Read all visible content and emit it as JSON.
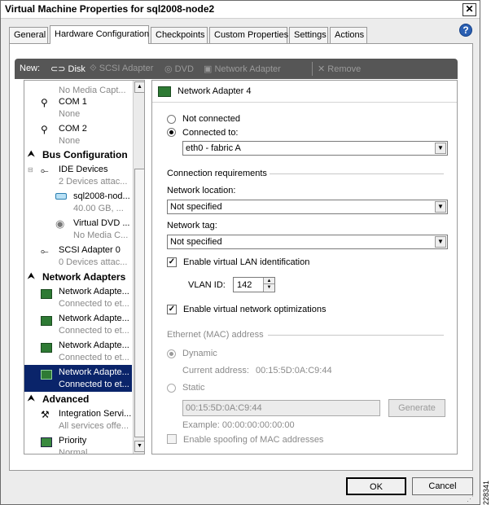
{
  "window": {
    "title": "Virtual Machine Properties for sql2008-node2",
    "close": "✕",
    "help": "?"
  },
  "tabs": [
    {
      "label": "General"
    },
    {
      "label": "Hardware Configuration"
    },
    {
      "label": "Checkpoints"
    },
    {
      "label": "Custom Properties"
    },
    {
      "label": "Settings"
    },
    {
      "label": "Actions"
    }
  ],
  "toolbar": {
    "new_label": "New:",
    "disk": "Disk",
    "scsi": "SCSI Adapter",
    "dvd": "DVD",
    "netadapter": "Network Adapter",
    "remove": "Remove"
  },
  "tree": {
    "rows": [
      {
        "t1": "",
        "t2": "No Media Capt..."
      },
      {
        "t1": "COM 1",
        "t2": "None"
      },
      {
        "t1": "COM 2",
        "t2": "None"
      },
      {
        "section": "Bus Configuration"
      },
      {
        "t1": "IDE Devices",
        "t2": "2 Devices attac..."
      },
      {
        "t1": "sql2008-nod...",
        "t2": "40.00 GB, ..."
      },
      {
        "t1": "Virtual DVD ...",
        "t2": "No Media C..."
      },
      {
        "t1": "SCSI Adapter 0",
        "t2": "0 Devices attac..."
      },
      {
        "section": "Network Adapters"
      },
      {
        "t1": "Network Adapte...",
        "t2": "Connected to et..."
      },
      {
        "t1": "Network Adapte...",
        "t2": "Connected to et..."
      },
      {
        "t1": "Network Adapte...",
        "t2": "Connected to et..."
      },
      {
        "t1": "Network Adapte...",
        "t2": "Connected to et..."
      },
      {
        "section": "Advanced"
      },
      {
        "t1": "Integration Servi...",
        "t2": "All services offe..."
      },
      {
        "t1": "Priority",
        "t2": "Normal"
      }
    ]
  },
  "detail": {
    "header": "Network Adapter 4",
    "not_connected": "Not connected",
    "connected_to": "Connected to:",
    "connected_value": "eth0 - fabric A",
    "conn_req": "Connection requirements",
    "net_location_label": "Network location:",
    "net_location_value": "Not specified",
    "net_tag_label": "Network tag:",
    "net_tag_value": "Not specified",
    "enable_vlan": "Enable virtual LAN identification",
    "vlan_label": "VLAN ID:",
    "vlan_value": "142",
    "enable_opt": "Enable virtual network optimizations",
    "mac_section": "Ethernet (MAC) address",
    "dynamic": "Dynamic",
    "current_label": "Current address:",
    "current_value": "00:15:5D:0A:C9:44",
    "static": "Static",
    "static_value": "00:15:5D:0A:C9:44",
    "generate": "Generate",
    "example": "Example: 00:00:00:00:00:00",
    "spoofing": "Enable spoofing of MAC addresses"
  },
  "footer": {
    "ok": "OK",
    "cancel": "Cancel",
    "side_id": "228341"
  }
}
